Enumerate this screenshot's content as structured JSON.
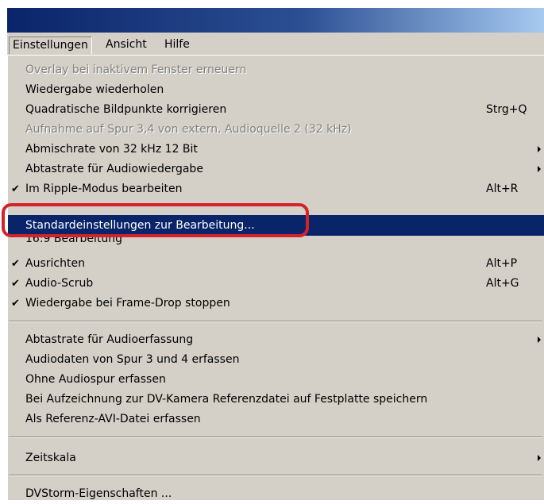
{
  "menubar": {
    "items": [
      {
        "label": "Einstellungen"
      },
      {
        "label": "Ansicht"
      },
      {
        "label": "Hilfe"
      }
    ]
  },
  "menu": {
    "items": [
      {
        "label": "Overlay bei inaktivem Fenster erneuern",
        "disabled": true
      },
      {
        "label": "Wiedergabe wiederholen"
      },
      {
        "label": "Quadratische Bildpunkte korrigieren",
        "shortcut": "Strg+Q"
      },
      {
        "label": "Aufnahme auf Spur 3,4 von extern. Audioquelle 2 (32 kHz)",
        "disabled": true
      },
      {
        "label": "Abmischrate von 32 kHz 12 Bit",
        "submenu": true
      },
      {
        "label": "Abtastrate für Audiowiedergabe",
        "submenu": true
      },
      {
        "label": "Im Ripple-Modus bearbeiten",
        "shortcut": "Alt+R",
        "checked": true
      },
      {
        "label": "Standardeinstellungen zur Bearbeitung...",
        "selected": true
      },
      {
        "label": "16:9 Bearbeitung"
      },
      {
        "label": "Ausrichten",
        "shortcut": "Alt+P",
        "checked": true
      },
      {
        "label": "Audio-Scrub",
        "shortcut": "Alt+G",
        "checked": true
      },
      {
        "label": "Wiedergabe bei Frame-Drop stoppen",
        "checked": true
      },
      {
        "label": "Abtastrate für Audioerfassung",
        "submenu": true
      },
      {
        "label": "Audiodaten von Spur 3 und 4 erfassen"
      },
      {
        "label": "Ohne Audiospur erfassen"
      },
      {
        "label": "Bei Aufzeichnung zur DV-Kamera Referenzdatei auf Festplatte speichern"
      },
      {
        "label": "Als Referenz-AVI-Datei erfassen"
      },
      {
        "label": "Zeitskala",
        "submenu": true
      },
      {
        "label": "DVStorm-Eigenschaften ..."
      }
    ],
    "check_glyph": "✔"
  },
  "colors": {
    "menu_bg": "#d4d0c8",
    "selection": "#0a246a",
    "highlight_frame": "#d2232a"
  }
}
